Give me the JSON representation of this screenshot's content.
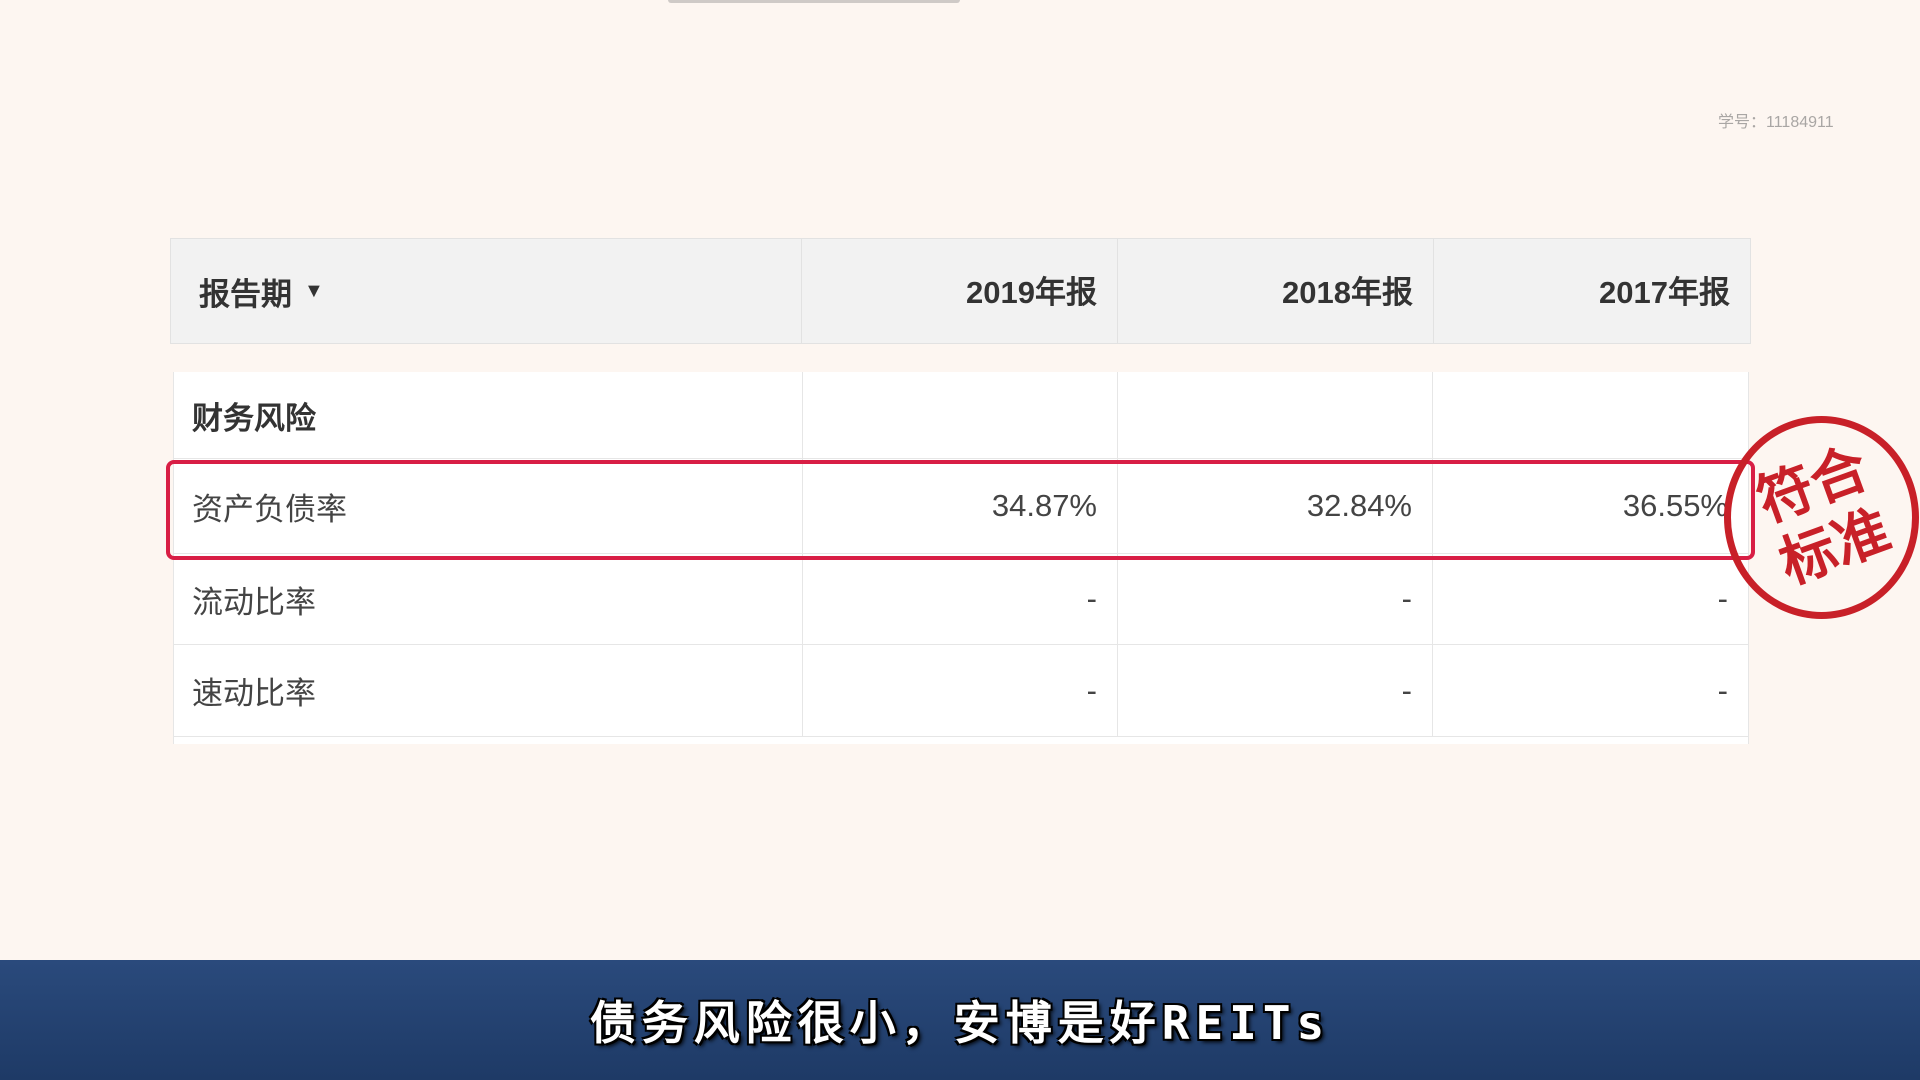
{
  "watermark": {
    "student_id": "学号：11184911"
  },
  "table": {
    "header": {
      "label": "报告期",
      "caret": "▼",
      "years": [
        "2019年报",
        "2018年报",
        "2017年报"
      ]
    },
    "section_title": "财务风险",
    "rows": [
      {
        "label": "资产负债率",
        "values": [
          "34.87%",
          "32.84%",
          "36.55%"
        ]
      },
      {
        "label": "流动比率",
        "values": [
          "-",
          "-",
          "-"
        ]
      },
      {
        "label": "速动比率",
        "values": [
          "-",
          "-",
          "-"
        ]
      }
    ]
  },
  "stamp": {
    "line1": "符合",
    "line2": "标准",
    "color": "#c82028"
  },
  "highlight": {
    "color": "#d81e45"
  },
  "subtitle": "债务风险很小，安博是好REITs",
  "colors": {
    "background": "#fdf6f1",
    "subtitle_bar": "#2a4a7c"
  }
}
